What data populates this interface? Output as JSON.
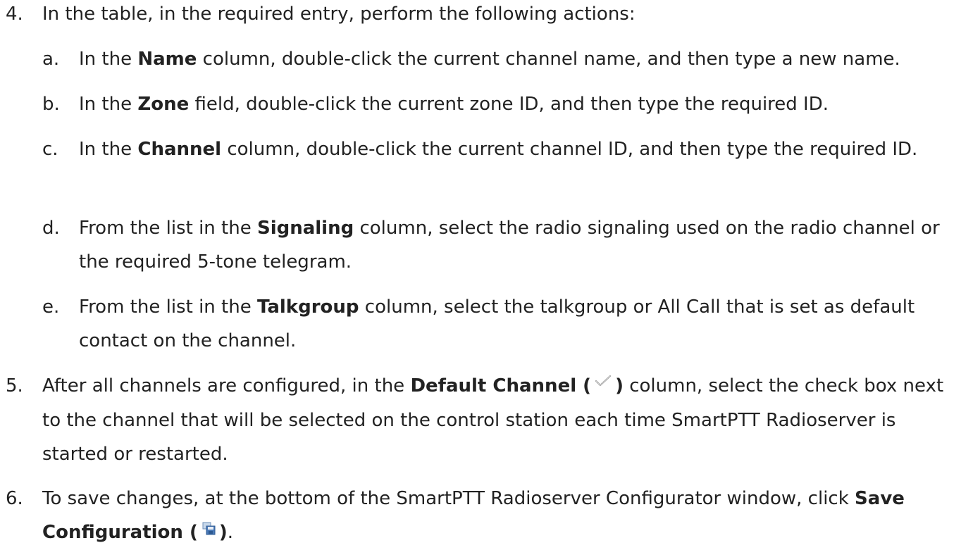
{
  "steps": [
    {
      "num": "4.",
      "lines": [
        {
          "t": "In the table, in the required entry, perform the following actions:"
        }
      ],
      "substeps": [
        {
          "letter": "a.",
          "pre": "In the ",
          "bold": "Name",
          "post": " column, double-click the current channel name, and then type a new name."
        },
        {
          "letter": "b.",
          "pre": "In the ",
          "bold": "Zone",
          "post": " field, double-click the current zone ID, and then type the required ID."
        },
        {
          "letter": "c.",
          "pre": "In the ",
          "bold": "Channel",
          "post": " column, double-click the current channel ID, and then type the required ID."
        },
        {
          "letter": "d.",
          "pre": "From the list in the ",
          "bold": "Signaling",
          "post": " column, select the radio signaling used on the radio channel or the required 5-tone telegram."
        },
        {
          "letter": "e.",
          "pre": "From the list in the ",
          "bold": "Talkgroup",
          "post": " column, select the talkgroup or All Call that is set as default contact on the channel."
        }
      ]
    },
    {
      "num": "5.",
      "pre": "After all channels are configured, in the ",
      "bold_a": "Default Channel (",
      "icon": "checkmark-icon",
      "bold_b": ")",
      "post": " column, select the check box next to the channel that will be selected on the control station each time SmartPTT Radioserver is started or restarted."
    },
    {
      "num": "6.",
      "pre": "To save changes, at the bottom of the SmartPTT Radioserver Configurator window, click ",
      "bold_a": "Save Configuration (",
      "icon": "save-configuration-icon",
      "bold_b": ")",
      "post": "."
    }
  ]
}
